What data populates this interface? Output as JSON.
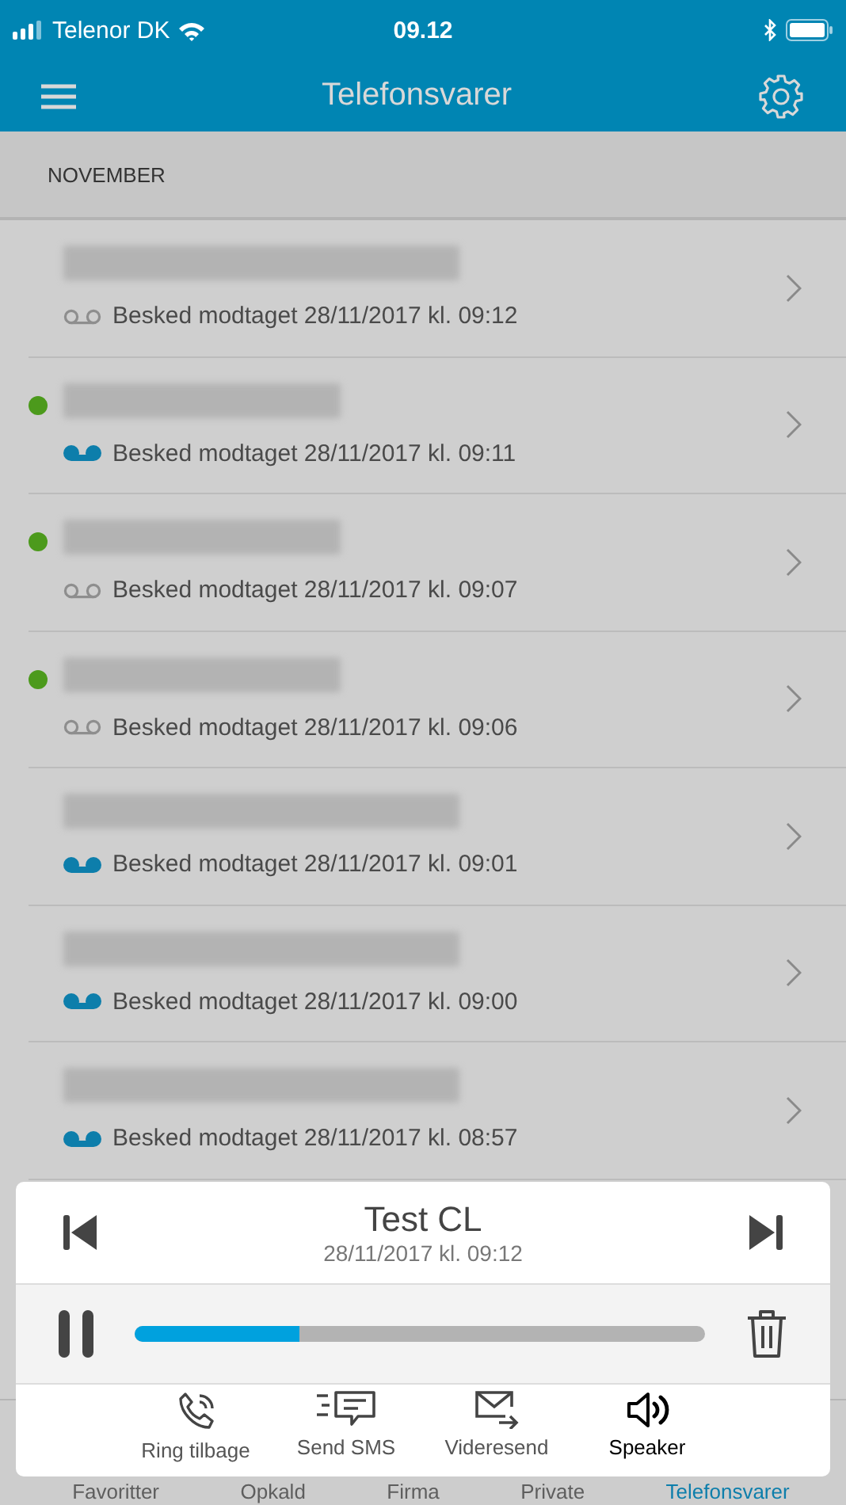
{
  "status_bar": {
    "carrier": "Telenor DK",
    "time": "09.12"
  },
  "header": {
    "title": "Telefonsvarer"
  },
  "section": {
    "title": "NOVEMBER"
  },
  "messages": [
    {
      "new": false,
      "played": true,
      "received": "Besked modtaget 28/11/2017 kl. 09:12"
    },
    {
      "new": true,
      "played": false,
      "received": "Besked modtaget 28/11/2017 kl. 09:11"
    },
    {
      "new": true,
      "played": true,
      "received": "Besked modtaget 28/11/2017 kl. 09:07"
    },
    {
      "new": true,
      "played": true,
      "received": "Besked modtaget 28/11/2017 kl. 09:06"
    },
    {
      "new": false,
      "played": false,
      "received": "Besked modtaget 28/11/2017 kl. 09:01"
    },
    {
      "new": false,
      "played": false,
      "received": "Besked modtaget 28/11/2017 kl. 09:00"
    },
    {
      "new": false,
      "played": false,
      "received": "Besked modtaget 28/11/2017 kl. 08:57"
    }
  ],
  "tabs": [
    {
      "label": "Favoritter",
      "selected": false
    },
    {
      "label": "Opkald",
      "selected": false
    },
    {
      "label": "Firma",
      "selected": false
    },
    {
      "label": "Private",
      "selected": false
    },
    {
      "label": "Telefonsvarer",
      "selected": true
    }
  ],
  "player": {
    "title": "Test CL",
    "date": "28/11/2017 kl. 09:12",
    "level": 0.29,
    "actions": [
      {
        "kind": "call",
        "label": "Ring tilbage",
        "active": false
      },
      {
        "kind": "sms",
        "label": "Send SMS",
        "active": false
      },
      {
        "kind": "forward",
        "label": "Videresend",
        "active": false
      },
      {
        "kind": "speaker",
        "label": "Speaker",
        "active": true
      }
    ]
  }
}
